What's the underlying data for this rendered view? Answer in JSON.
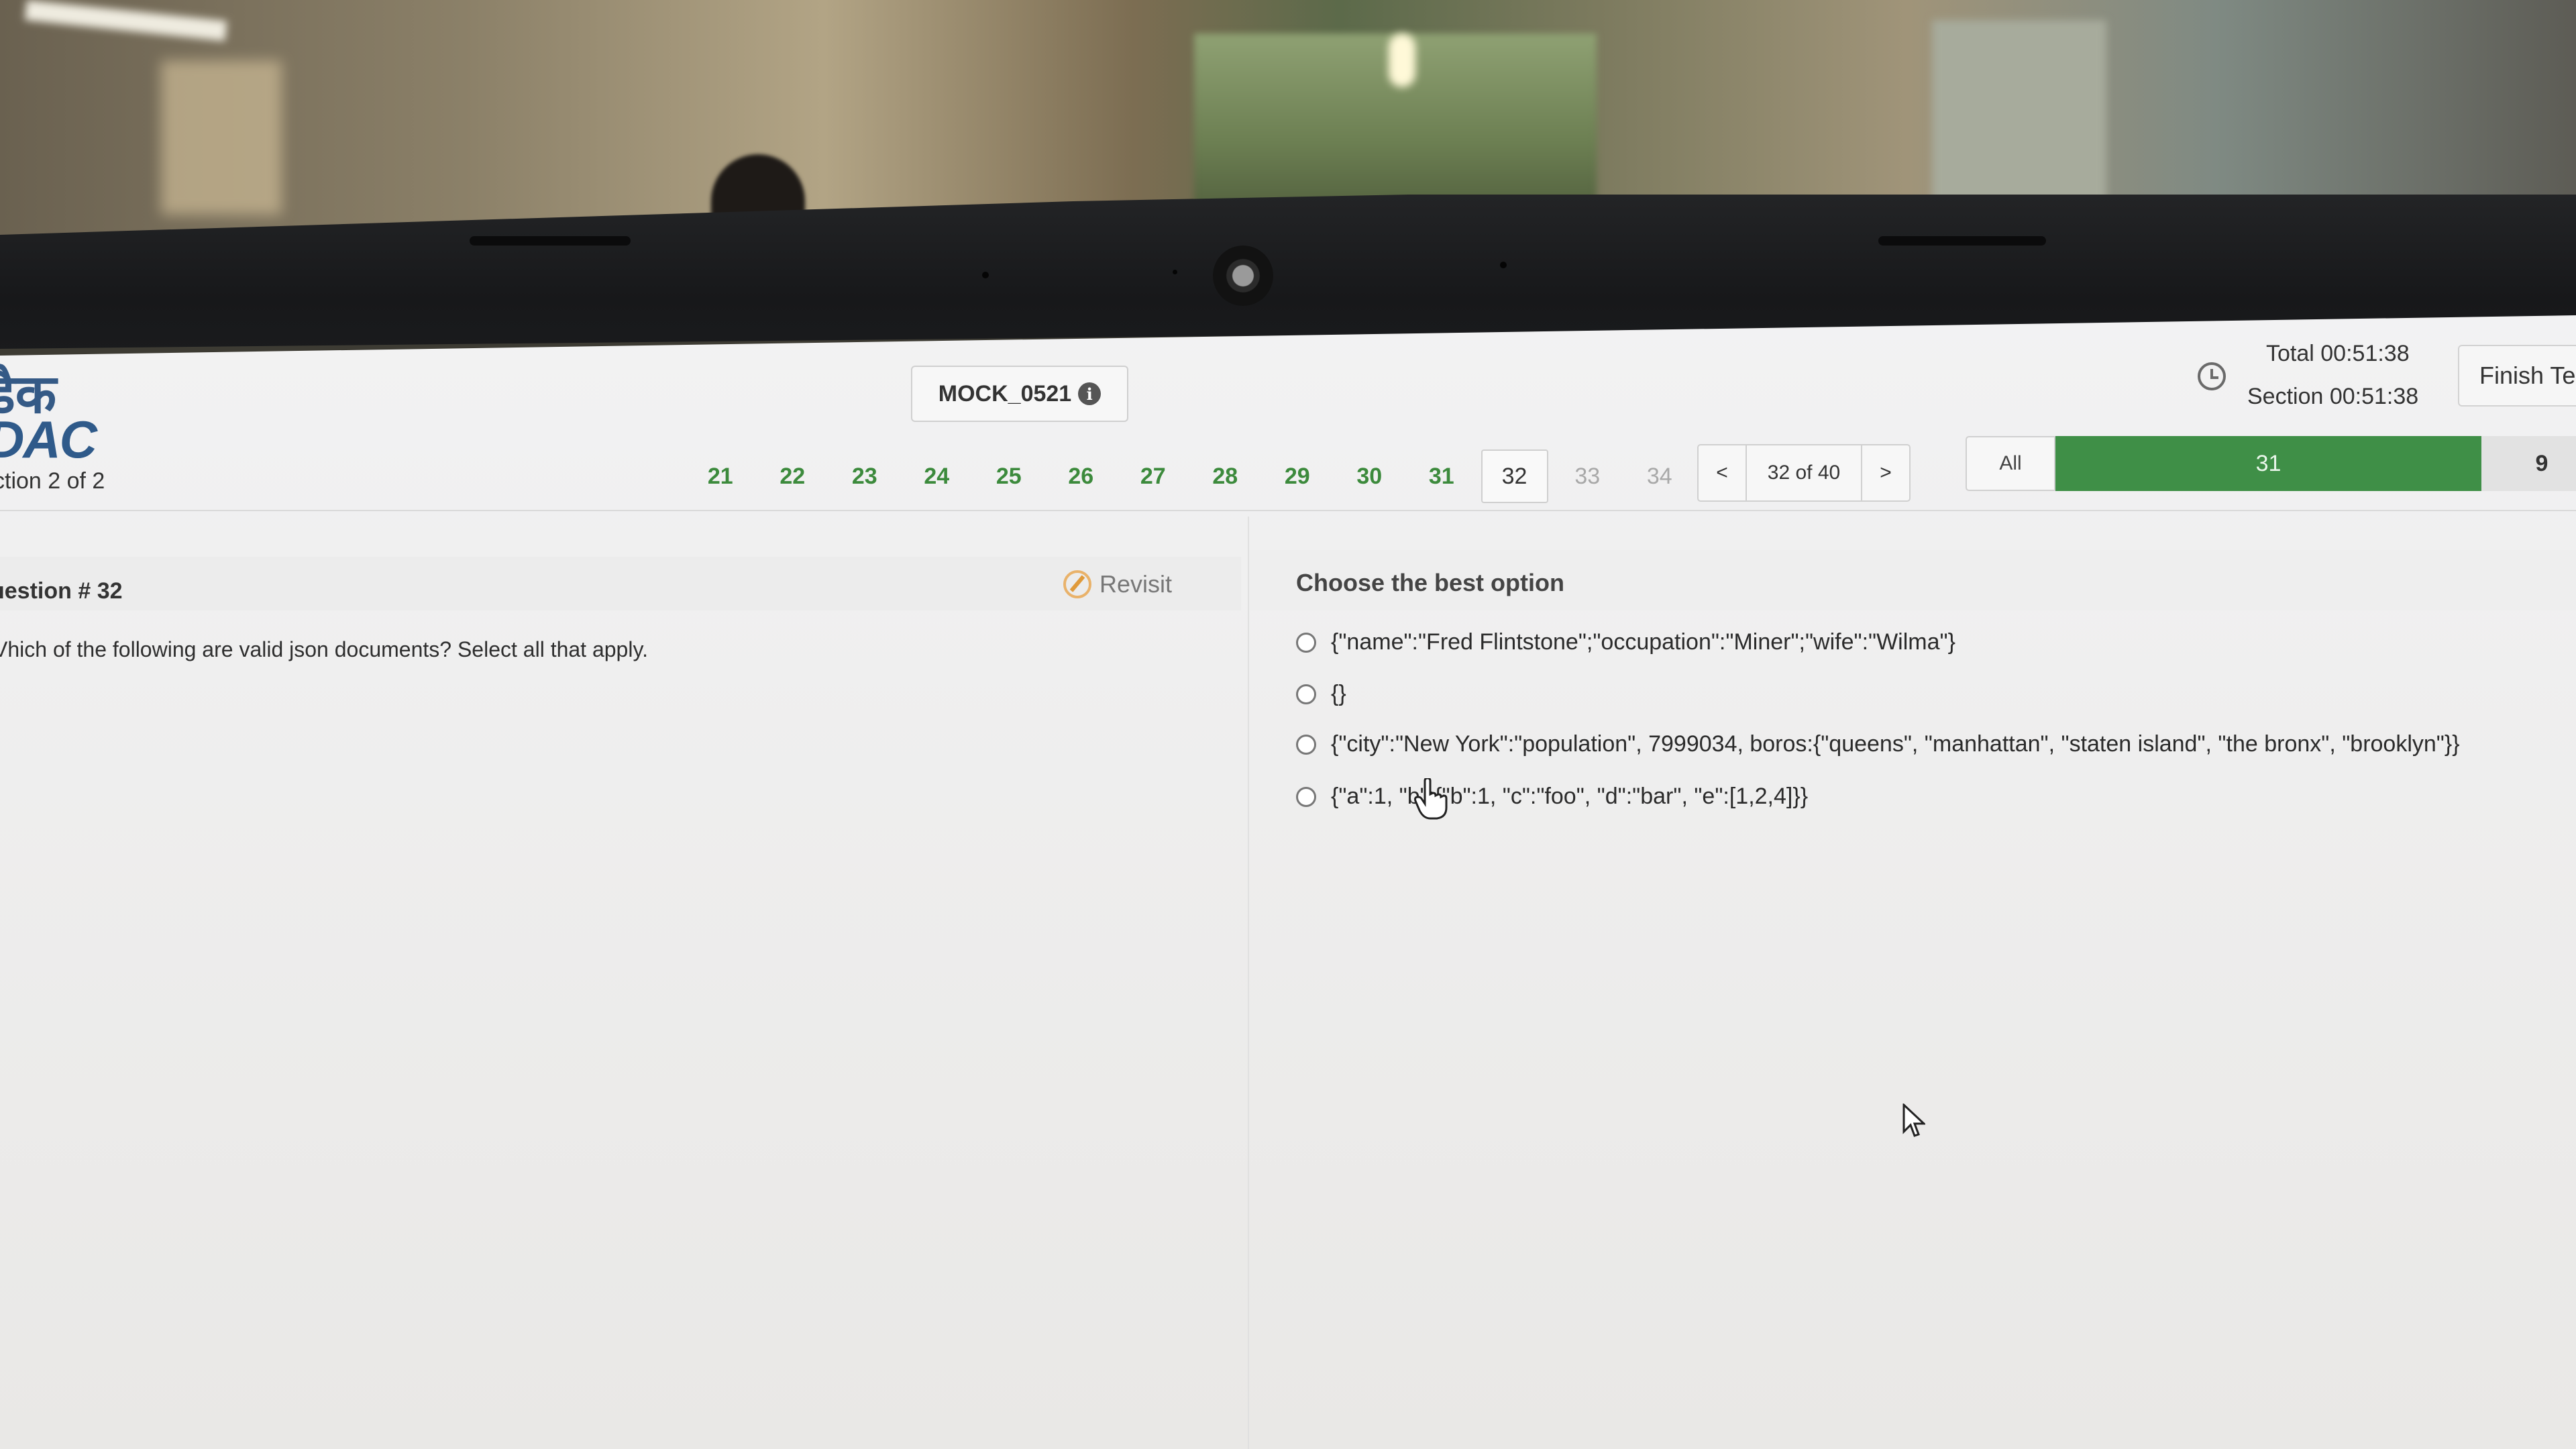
{
  "header": {
    "brand_hindi": "डैक",
    "brand_logo": "DAC",
    "section_label": "ction 2 of 2",
    "test_name": "MOCK_0521",
    "timer_total": "Total 00:51:38",
    "timer_section": "Section 00:51:38",
    "finish_label": "Finish Te"
  },
  "question_nav": {
    "numbers": [
      "21",
      "22",
      "23",
      "24",
      "25",
      "26",
      "27",
      "28",
      "29",
      "30",
      "31",
      "32",
      "33",
      "34"
    ],
    "current": "32",
    "prev_label": "<",
    "next_label": ">",
    "position_label": "32 of 40"
  },
  "status_bar": {
    "all_label": "All",
    "answered_count": "31",
    "other_count": "9",
    "answered_color": "#3f8f47"
  },
  "question": {
    "label": "uestion # 32",
    "revisit_label": "Revisit",
    "text": "Vhich of the following are valid json documents? Select all that apply."
  },
  "answers": {
    "heading": "Choose the best option",
    "options": [
      "{\"name\":\"Fred Flintstone\";\"occupation\":\"Miner\";\"wife\":\"Wilma\"}",
      "{}",
      "{\"city\":\"New York\":\"population\", 7999034, boros:{\"queens\", \"manhattan\", \"staten island\", \"the bronx\", \"brooklyn\"}}",
      "{\"a\":1, \"b\":{\"b\":1, \"c\":\"foo\", \"d\":\"bar\", \"e\":[1,2,4]}}"
    ]
  },
  "icons": {
    "info": "info-icon",
    "clock": "clock-icon",
    "revisit": "revisit-icon",
    "radio": "radio-icon",
    "hand_cursor": "hand-cursor-icon",
    "arrow_cursor": "arrow-cursor-icon",
    "info_glyph": "i"
  }
}
